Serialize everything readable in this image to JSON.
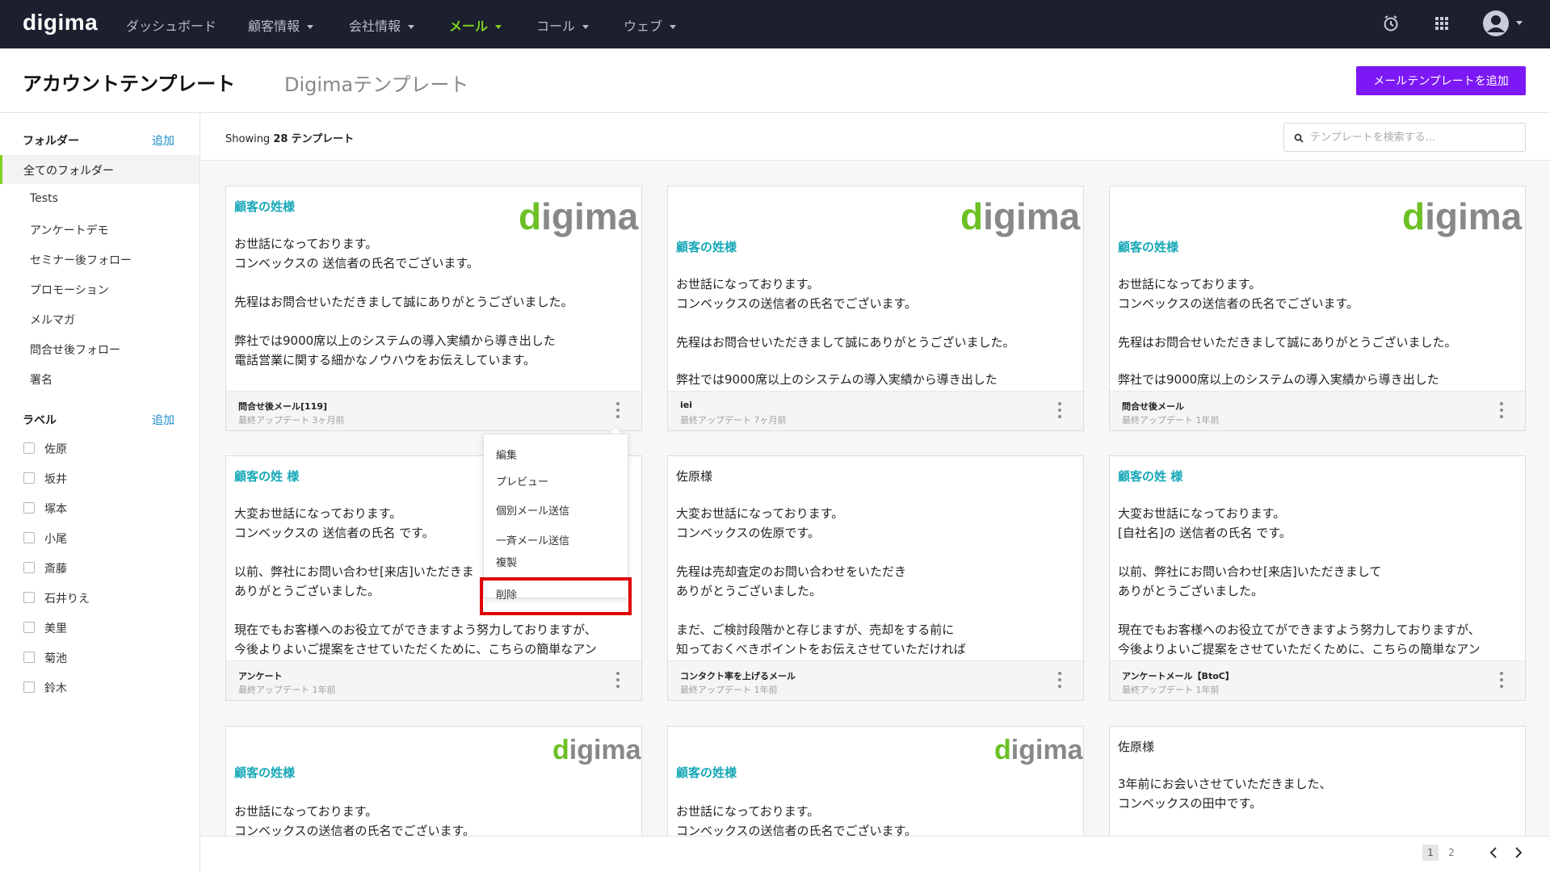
{
  "app": {
    "logo": "digima"
  },
  "nav": {
    "items": [
      {
        "label": "ダッシュボード",
        "dropdown": false
      },
      {
        "label": "顧客情報",
        "dropdown": true
      },
      {
        "label": "会社情報",
        "dropdown": true
      },
      {
        "label": "メール",
        "dropdown": true,
        "active": true
      },
      {
        "label": "コール",
        "dropdown": true
      },
      {
        "label": "ウェブ",
        "dropdown": true
      }
    ],
    "icons": [
      "clock-icon",
      "apps-grid-icon",
      "user-avatar-icon"
    ],
    "active_color": "#7ed321"
  },
  "header": {
    "title": "アカウントテンプレート",
    "tab": "Digimaテンプレート",
    "add_button": "メールテンプレートを追加",
    "add_button_color": "#7c18f5"
  },
  "sidebar": {
    "folders_title": "フォルダー",
    "folders_add": "追加",
    "folders": [
      "全てのフォルダー",
      "Tests",
      "アンケートデモ",
      "セミナー後フォロー",
      "プロモーション",
      "メルマガ",
      "問合せ後フォロー",
      "署名"
    ],
    "labels_title": "ラベル",
    "labels_add": "追加",
    "labels": [
      "佐原",
      "坂井",
      "塚本",
      "小尾",
      "斎藤",
      "石井りえ",
      "美里",
      "菊池",
      "鈴木"
    ]
  },
  "toolbar": {
    "showing_prefix": "Showing",
    "showing_count": "28",
    "showing_suffix": "テンプレート",
    "search_placeholder": "テンプレートを検索する..."
  },
  "cards": [
    {
      "logo": "digima",
      "lines": [
        "顧客の姓様",
        "お世話になっております。",
        "コンベックスの 送信者の氏名でございます。",
        "先程はお問合せいただきまして誠にありがとうございました。",
        "弊社では9000席以上のシステムの導入実績から導き出した",
        "電話営業に関する細かなノウハウをお伝えしています。"
      ],
      "name": "問合せ後メール[119]",
      "updated": "最終アップデート 3ヶ月前"
    },
    {
      "logo": "digima",
      "lines": [
        "顧客の姓様",
        "お世話になっております。",
        "コンベックスの送信者の氏名でございます。",
        "先程はお問合せいただきまして誠にありがとうございました。",
        "弊社では9000席以上のシステムの導入実績から導き出した"
      ],
      "name": "iei",
      "updated": "最終アップデート 7ヶ月前"
    },
    {
      "logo": "digima",
      "lines": [
        "顧客の姓様",
        "お世話になっております。",
        "コンベックスの送信者の氏名でございます。",
        "先程はお問合せいただきまして誠にありがとうございました。",
        "弊社では9000席以上のシステムの導入実績から導き出した"
      ],
      "name": "問合せ後メール",
      "updated": "最終アップデート 1年前"
    },
    {
      "lines": [
        "顧客の姓 様",
        "大変お世話になっております。",
        "コンベックスの 送信者の氏名 です。",
        "以前、弊社にお問い合わせ[来店]いただきま",
        "ありがとうございました。",
        "現在でもお客様へのお役立てができますよう努力しておりますが、",
        "今後よりよいご提案をさせていただくために、こちらの簡単なアン"
      ],
      "name": "アンケート",
      "updated": "最終アップデート 1年前"
    },
    {
      "lines": [
        "佐原様",
        "大変お世話になっております。",
        "コンベックスの佐原です。",
        "先程は売却査定のお問い合わせをいただき",
        "ありがとうございました。",
        "まだ、ご検討段階かと存じますが、売却をする前に",
        "知っておくべきポイントをお伝えさせていただければ"
      ],
      "name": "コンタクト率を上げるメール",
      "updated": "最終アップデート 1年前"
    },
    {
      "lines": [
        "顧客の姓 様",
        "大変お世話になっております。",
        "[自社名]の 送信者の氏名 です。",
        "以前、弊社にお問い合わせ[来店]いただきまして",
        "ありがとうございました。",
        "現在でもお客様へのお役立てができますよう努力しておりますが、",
        "今後よりよいご提案をさせていただくために、こちらの簡単なアン"
      ],
      "name": "アンケートメール【BtoC】",
      "updated": "最終アップデート 1年前"
    },
    {
      "logo": "digima",
      "lines": [
        "顧客の姓様",
        "お世話になっております。",
        "コンベックスの送信者の氏名でございます。"
      ]
    },
    {
      "logo": "digima",
      "lines": [
        "顧客の姓様",
        "お世話になっております。",
        "コンベックスの送信者の氏名でございます。"
      ]
    },
    {
      "lines": [
        "佐原様",
        "3年前にお会いさせていただきました、",
        "コンベックスの田中です。"
      ]
    }
  ],
  "context_menu": {
    "items": [
      "編集",
      "プレビュー",
      "個別メール送信",
      "一斉メール送信",
      "複製",
      "削除"
    ],
    "highlighted": "削除",
    "highlight_color": "#e00000"
  },
  "pagination": {
    "pages": [
      "1",
      "2"
    ],
    "current": "1"
  },
  "colors": {
    "placeholder_text": "#17a8b8",
    "link": "#6a2aa8",
    "nav_bg": "#1b1f2e"
  }
}
